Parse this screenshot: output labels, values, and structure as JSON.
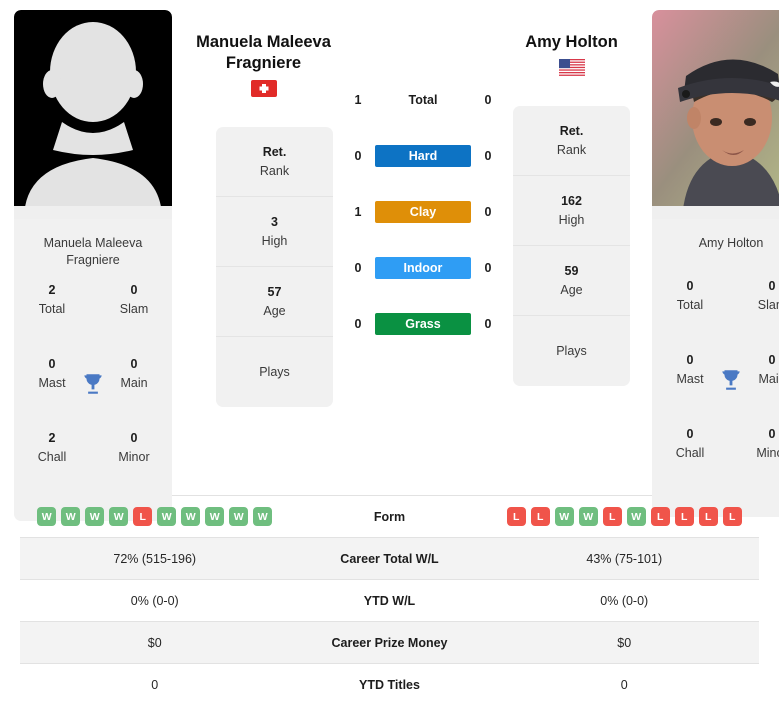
{
  "players": {
    "left": {
      "name": "Manuela Maleeva Fragniere",
      "card_name": "Manuela Maleeva Fragniere",
      "country": "Switzerland",
      "flag_icon": "flag-switzerland",
      "photo_type": "silhouette-placeholder",
      "titles": {
        "total_value": "2",
        "total_label": "Total",
        "slam_value": "0",
        "slam_label": "Slam",
        "mast_value": "0",
        "mast_label": "Mast",
        "main_value": "0",
        "main_label": "Main",
        "chall_value": "2",
        "chall_label": "Chall",
        "minor_value": "0",
        "minor_label": "Minor"
      },
      "panel": {
        "rank_value": "Ret.",
        "rank_label": "Rank",
        "high_value": "3",
        "high_label": "High",
        "age_value": "57",
        "age_label": "Age",
        "plays_value": "",
        "plays_label": "Plays"
      },
      "form": [
        "W",
        "W",
        "W",
        "W",
        "L",
        "W",
        "W",
        "W",
        "W",
        "W"
      ],
      "career_wl": "72% (515-196)",
      "ytd_wl": "0% (0-0)",
      "prize_money": "$0",
      "ytd_titles": "0"
    },
    "right": {
      "name": "Amy Holton",
      "card_name": "Amy Holton",
      "country": "United States",
      "flag_icon": "flag-usa",
      "photo_type": "player-photo",
      "titles": {
        "total_value": "0",
        "total_label": "Total",
        "slam_value": "0",
        "slam_label": "Slam",
        "mast_value": "0",
        "mast_label": "Mast",
        "main_value": "0",
        "main_label": "Main",
        "chall_value": "0",
        "chall_label": "Chall",
        "minor_value": "0",
        "minor_label": "Minor"
      },
      "panel": {
        "rank_value": "Ret.",
        "rank_label": "Rank",
        "high_value": "162",
        "high_label": "High",
        "age_value": "59",
        "age_label": "Age",
        "plays_value": "",
        "plays_label": "Plays"
      },
      "form": [
        "L",
        "L",
        "W",
        "W",
        "L",
        "W",
        "L",
        "L",
        "L",
        "L"
      ],
      "career_wl": "43% (75-101)",
      "ytd_wl": "0% (0-0)",
      "prize_money": "$0",
      "ytd_titles": "0"
    }
  },
  "surfaces": [
    {
      "label": "Total",
      "left": "1",
      "right": "0",
      "color": "transparent",
      "plain": true
    },
    {
      "label": "Hard",
      "left": "0",
      "right": "0",
      "color": "#0d73c4",
      "plain": false
    },
    {
      "label": "Clay",
      "left": "1",
      "right": "0",
      "color": "#df8f08",
      "plain": false
    },
    {
      "label": "Indoor",
      "left": "0",
      "right": "0",
      "color": "#2f9df4",
      "plain": false
    },
    {
      "label": "Grass",
      "left": "0",
      "right": "0",
      "color": "#0a9142",
      "plain": false
    }
  ],
  "stats_rows": [
    {
      "label": "Form",
      "key": "form",
      "shaded": false,
      "type": "badges"
    },
    {
      "label": "Career Total W/L",
      "key": "career_wl",
      "shaded": true,
      "type": "text"
    },
    {
      "label": "YTD W/L",
      "key": "ytd_wl",
      "shaded": false,
      "type": "text"
    },
    {
      "label": "Career Prize Money",
      "key": "prize_money",
      "shaded": true,
      "type": "text"
    },
    {
      "label": "YTD Titles",
      "key": "ytd_titles",
      "shaded": false,
      "type": "text"
    }
  ],
  "colors": {
    "card_bg": "#f1f1f1",
    "win_badge": "#6fbe7f",
    "loss_badge": "#f0544a",
    "trophy": "#4a79c4",
    "row_shade": "#f3f3f3"
  }
}
